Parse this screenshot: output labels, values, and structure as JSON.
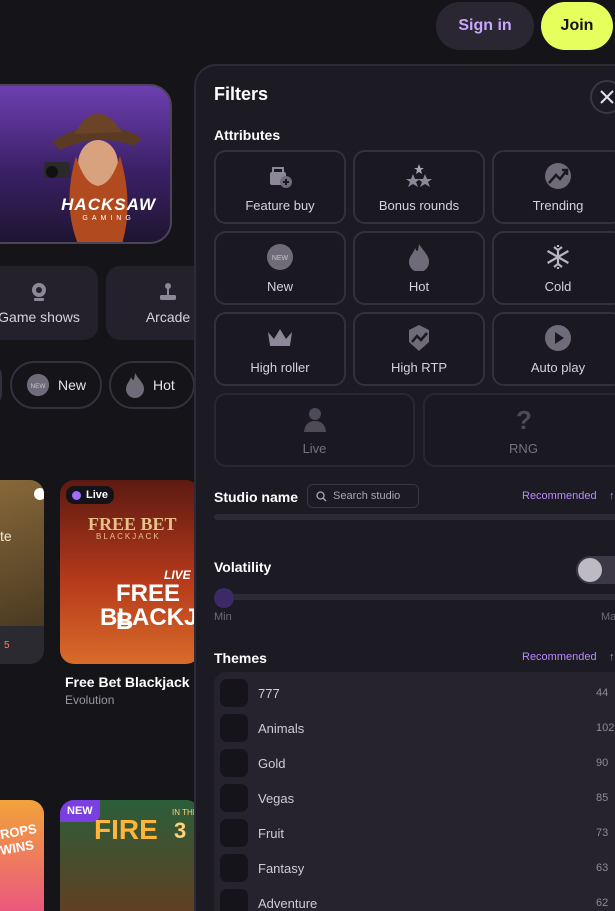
{
  "header": {
    "signin_label": "Sign in",
    "join_label": "Join"
  },
  "banner": {
    "brand": "HACKSAW",
    "brand_sub": "GAMING"
  },
  "categories": [
    {
      "label": "Game shows",
      "icon": "webcam-icon"
    },
    {
      "label": "Arcade",
      "icon": "joystick-icon"
    }
  ],
  "chips": [
    {
      "label": "New",
      "icon": "new-badge-icon"
    },
    {
      "label": "Hot",
      "icon": "flame-icon"
    }
  ],
  "games": {
    "left_card_fragment": "te",
    "left_card_number": "5",
    "free_bet": {
      "badge": "Live",
      "logo_top": "FREE BET",
      "logo_sub": "BLACKJACK",
      "live_text": "LIVE",
      "big_text_1": "FREE B",
      "big_text_2": "BLACKJ",
      "title": "Free Bet Blackjack",
      "studio": "Evolution"
    },
    "bottom_left": {
      "text_1": "ROPS",
      "text_2": "WINS"
    },
    "fire": {
      "badge": "NEW",
      "logo": "FIRE",
      "logo_small": "IN THE",
      "logo_num": "3"
    }
  },
  "filters": {
    "title": "Filters",
    "attributes_title": "Attributes",
    "attributes": [
      {
        "label": "Feature buy",
        "icon": "feature-buy-icon",
        "enabled": true
      },
      {
        "label": "Bonus rounds",
        "icon": "bonus-rounds-icon",
        "enabled": true
      },
      {
        "label": "Trending",
        "icon": "trending-icon",
        "enabled": true
      },
      {
        "label": "New",
        "icon": "new-badge-icon",
        "enabled": true
      },
      {
        "label": "Hot",
        "icon": "flame-icon",
        "enabled": true
      },
      {
        "label": "Cold",
        "icon": "snowflake-icon",
        "enabled": true
      },
      {
        "label": "High roller",
        "icon": "crown-icon",
        "enabled": true
      },
      {
        "label": "High RTP",
        "icon": "high-rtp-icon",
        "enabled": true
      },
      {
        "label": "Auto play",
        "icon": "auto-play-icon",
        "enabled": true
      },
      {
        "label": "Live",
        "icon": "dealer-icon",
        "enabled": false
      },
      {
        "label": "RNG",
        "icon": "question-icon",
        "enabled": false
      }
    ],
    "studio_title": "Studio name",
    "studio_placeholder": "Search studio",
    "sort_label": "Recommended",
    "sort_arrow": "↑",
    "volatility_title": "Volatility",
    "volatility_enabled": false,
    "min_label": "Min",
    "max_label": "Ma",
    "themes_title": "Themes",
    "themes": [
      {
        "label": "777",
        "count": "44"
      },
      {
        "label": "Animals",
        "count": "102"
      },
      {
        "label": "Gold",
        "count": "90"
      },
      {
        "label": "Vegas",
        "count": "85"
      },
      {
        "label": "Fruit",
        "count": "73"
      },
      {
        "label": "Fantasy",
        "count": "63"
      },
      {
        "label": "Adventure",
        "count": "62"
      }
    ]
  },
  "colors": {
    "accent": "#b88bff",
    "join": "#e6ff5c",
    "bg": "#151419",
    "panel": "#1c1a22"
  }
}
